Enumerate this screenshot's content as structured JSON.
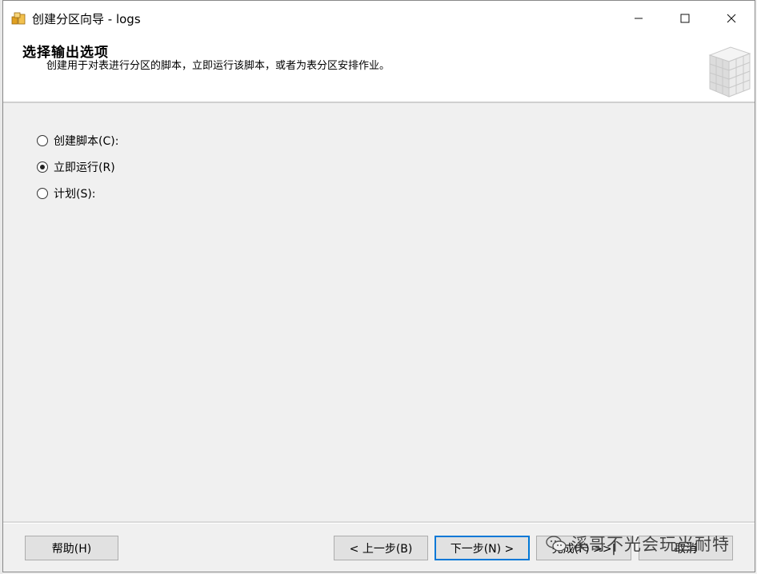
{
  "window": {
    "title": "创建分区向导 - logs",
    "controls": {
      "minimize": "minimize",
      "maximize": "maximize",
      "close": "close"
    }
  },
  "header": {
    "title": "选择输出选项",
    "description": "创建用于对表进行分区的脚本，立即运行该脚本，或者为表分区安排作业。"
  },
  "options": [
    {
      "label": "创建脚本(C):",
      "checked": false
    },
    {
      "label": "立即运行(R)",
      "checked": true
    },
    {
      "label": "计划(S):",
      "checked": false
    }
  ],
  "buttons": {
    "help": "帮助(H)",
    "back": "< 上一步(B)",
    "next": "下一步(N) >",
    "finish": "完成(F) >>|",
    "cancel": "取消"
  },
  "watermark": "溪哥不光会玩当耐特",
  "colors": {
    "accent": "#0078d7",
    "background": "#f0f0f0"
  }
}
